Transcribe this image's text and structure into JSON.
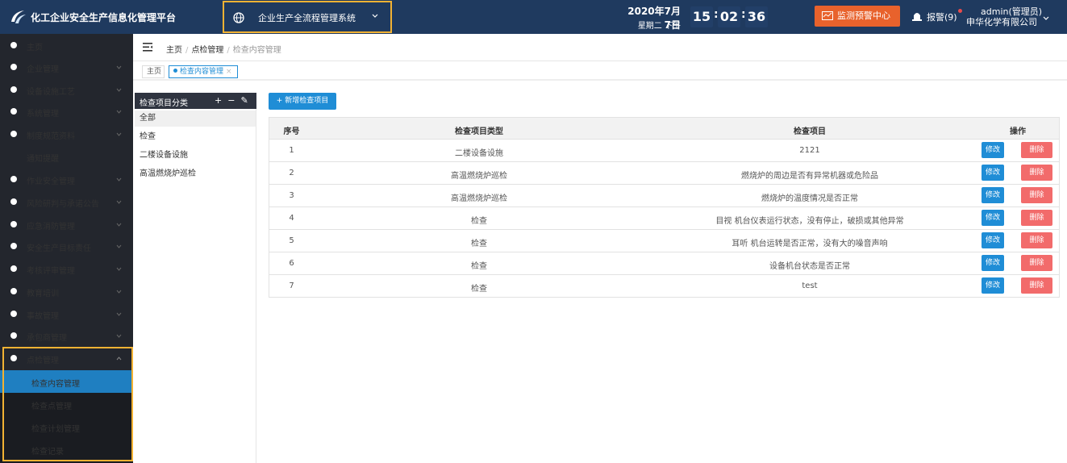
{
  "header": {
    "app_title": "化工企业安全生产信息化管理平台",
    "system_select": "企业生产全流程管理系统",
    "date": "2020年7月7日",
    "weekday": "星期二 下午",
    "time": {
      "h": "15",
      "m": "02",
      "s": "36"
    },
    "monitor_button": "监测预警中心",
    "alarm": "报警(9)",
    "user_name": "admin(管理员)",
    "company": "申华化学有限公司"
  },
  "sidebar": {
    "items": [
      {
        "label": "主页"
      },
      {
        "label": "企业管理"
      },
      {
        "label": "设备设施工艺"
      },
      {
        "label": "系统管理"
      },
      {
        "label": "制度规范资料"
      },
      {
        "label": "通知提醒"
      },
      {
        "label": "作业安全管理"
      },
      {
        "label": "风险研判与承诺公告"
      },
      {
        "label": "应急消防管理"
      },
      {
        "label": "安全生产目标责任"
      },
      {
        "label": "考核评审管理"
      },
      {
        "label": "教育培训"
      },
      {
        "label": "事故管理"
      },
      {
        "label": "承包商管理"
      },
      {
        "label": "点检管理"
      }
    ],
    "subitems": [
      {
        "label": "检查内容管理"
      },
      {
        "label": "检查点管理"
      },
      {
        "label": "检查计划管理"
      },
      {
        "label": "检查记录"
      }
    ]
  },
  "breadcrumb": {
    "home": "主页",
    "parent": "点检管理",
    "current": "检查内容管理"
  },
  "tabs": {
    "home": "主页",
    "active": "检查内容管理"
  },
  "category": {
    "title": "检查项目分类",
    "items": [
      "全部",
      "检查",
      "二楼设备设施",
      "高温燃烧炉巡检"
    ]
  },
  "main": {
    "add_button": "+ 新增检查项目",
    "columns": [
      "序号",
      "检查项目类型",
      "检查项目",
      "操作"
    ],
    "edit_label": "修改",
    "delete_label": "删除",
    "rows": [
      [
        "1",
        "二楼设备设施",
        "2121"
      ],
      [
        "2",
        "高温燃烧炉巡检",
        "燃烧炉的周边是否有异常机器或危险品"
      ],
      [
        "3",
        "高温燃烧炉巡检",
        "燃烧炉的温度情况是否正常"
      ],
      [
        "4",
        "检查",
        "目视 机台仪表运行状态，没有停止，破损或其他异常"
      ],
      [
        "5",
        "检查",
        "耳听 机台运转是否正常，没有大的噪音声响"
      ],
      [
        "6",
        "检查",
        "设备机台状态是否正常"
      ],
      [
        "7",
        "检查",
        "test"
      ]
    ]
  },
  "colors": {
    "header_bg": "#1f3a5f",
    "accent": "#1f8dd6",
    "danger": "#f26b6b",
    "warning": "#e8622c",
    "highlight": "#f2b233"
  }
}
